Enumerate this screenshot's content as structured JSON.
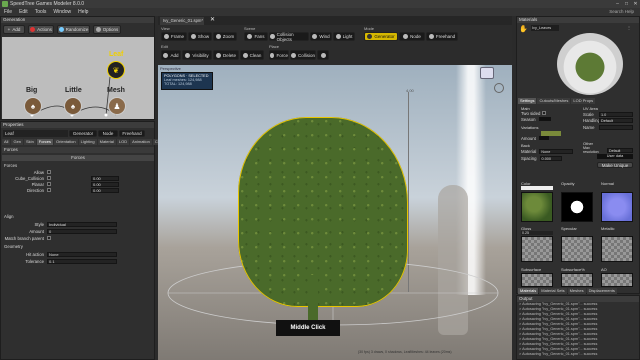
{
  "window": {
    "title": "SpeedTree Games Modeler 8.0.0",
    "search": "Search Help"
  },
  "menu": [
    "File",
    "Edit",
    "Tools",
    "Window",
    "Help"
  ],
  "generation": {
    "title": "Generation",
    "buttons": [
      "Add",
      "Actions",
      "Randomize",
      "Options"
    ],
    "nodes": {
      "big": "Big",
      "little": "Little",
      "mesh": "Mesh",
      "leaf": "Leaf"
    }
  },
  "document_tab": {
    "label": "Ivy_Generic_01.spm*",
    "close": "✕"
  },
  "toolbar": {
    "view_label": "View",
    "view_buttons": [
      "Frame",
      "Show",
      "Zoom"
    ],
    "scene_label": "Scene",
    "scene_buttons": [
      "Fans",
      "Collision Objects",
      "Wind",
      "Light"
    ],
    "mode_label": "Mode",
    "mode_buttons": [
      "Generator",
      "Node",
      "Freehand"
    ],
    "edit_label": "Edit",
    "edit_buttons": [
      "Add",
      "Visibility",
      "Delete",
      "Clean"
    ],
    "place_label": "Place",
    "place_buttons": [
      "Force",
      "Collision",
      "Mesh"
    ]
  },
  "viewport": {
    "header": "Perspective",
    "stats_title": "POLYGONS · SELECTED",
    "stats_leaf": "Leaf meshes: 124,988",
    "stats_total": "TOTAL: 124,988",
    "status": "(30 fps) 3 draws, 0 shadows, LeafMeshes: 44 leaves (20ms)",
    "caption": "Middle Click",
    "axis_label": "4.00"
  },
  "properties": {
    "title": "Properties",
    "object": "Leaf",
    "mode_buttons": [
      "Generator",
      "Node",
      "Freehand"
    ],
    "tabs": [
      "All",
      "Gen",
      "Skin",
      "Forces",
      "Orientation",
      "Lighting",
      "Material",
      "LOD",
      "Animation",
      "Collision"
    ],
    "active_tab": "Forces",
    "section": "Forces",
    "subheader": "Forces",
    "rows": [
      {
        "label": "Allow",
        "value": ""
      },
      {
        "label": "Cube_Collision",
        "value": "0.00"
      },
      {
        "label": "Planar",
        "value": "0.00"
      },
      {
        "label": "Direction",
        "value": "0.00"
      }
    ],
    "align_label": "Align",
    "style_label": "Style",
    "style_value": "Individual",
    "amount_label": "Amount",
    "amount_value": "0",
    "match_label": "Match branch parent",
    "geometry_label": "Geometry",
    "hit_label": "Hit action",
    "hit_value": "None",
    "tolerance_label": "Tolerance",
    "tolerance_value": "0.1"
  },
  "materials": {
    "title": "Materials",
    "selected": "Ivy_Leaves",
    "tabs": [
      "Settings",
      "Cutouts/Meshes",
      "LOD Props"
    ],
    "main_label": "Main",
    "two_sided": "Two sided",
    "season": "Season",
    "variations": "Variations",
    "amount": "Amount",
    "back": "Back",
    "material": "Material",
    "material_value": "None",
    "spacing": "Spacing",
    "spacing_value": "0.000",
    "uv_label": "UV Area",
    "scale": "Scale",
    "scale_value": "1.0",
    "handling": "Handling",
    "handling_value": "Default",
    "name": "Name",
    "other_label": "Other",
    "resolution": "Max resolution",
    "resolution_value": "Default",
    "user_data": "User data",
    "make_unique": "Make Unique",
    "maps": [
      "Color",
      "Opacity",
      "Normal",
      "Gloss",
      "Specular",
      "Metallic",
      "Subsurface",
      "Subsurface%",
      "AO"
    ],
    "color_value": "0.25",
    "bottom_tabs": [
      "Materials",
      "Material Sets",
      "Meshes",
      "Displacements"
    ]
  },
  "output": {
    "title": "Output",
    "lines": [
      "> Autosaving \"Ivy_Generic_01.spm\"... success",
      "> Autosaving \"Ivy_Generic_01.spm\"... success",
      "> Autosaving \"Ivy_Generic_01.spm\"... success",
      "> Autosaving \"Ivy_Generic_01.spm\"... success",
      "> Autosaving \"Ivy_Generic_01.spm\"... success",
      "> Autosaving \"Ivy_Generic_01.spm\"... success",
      "> Autosaving \"Ivy_Generic_01.spm\"... success",
      "> Autosaving \"Ivy_Generic_01.spm\"... success",
      "> Autosaving \"Ivy_Generic_01.spm\"... success",
      "> Autosaving \"Ivy_Generic_01.spm\"... success",
      "> Autosaving \"Ivy_Generic_01.spm\"... success"
    ]
  },
  "colors": {
    "accent": "#e8c500",
    "leaf_green": "#4a6a2a",
    "sky": "#c9d2da"
  }
}
